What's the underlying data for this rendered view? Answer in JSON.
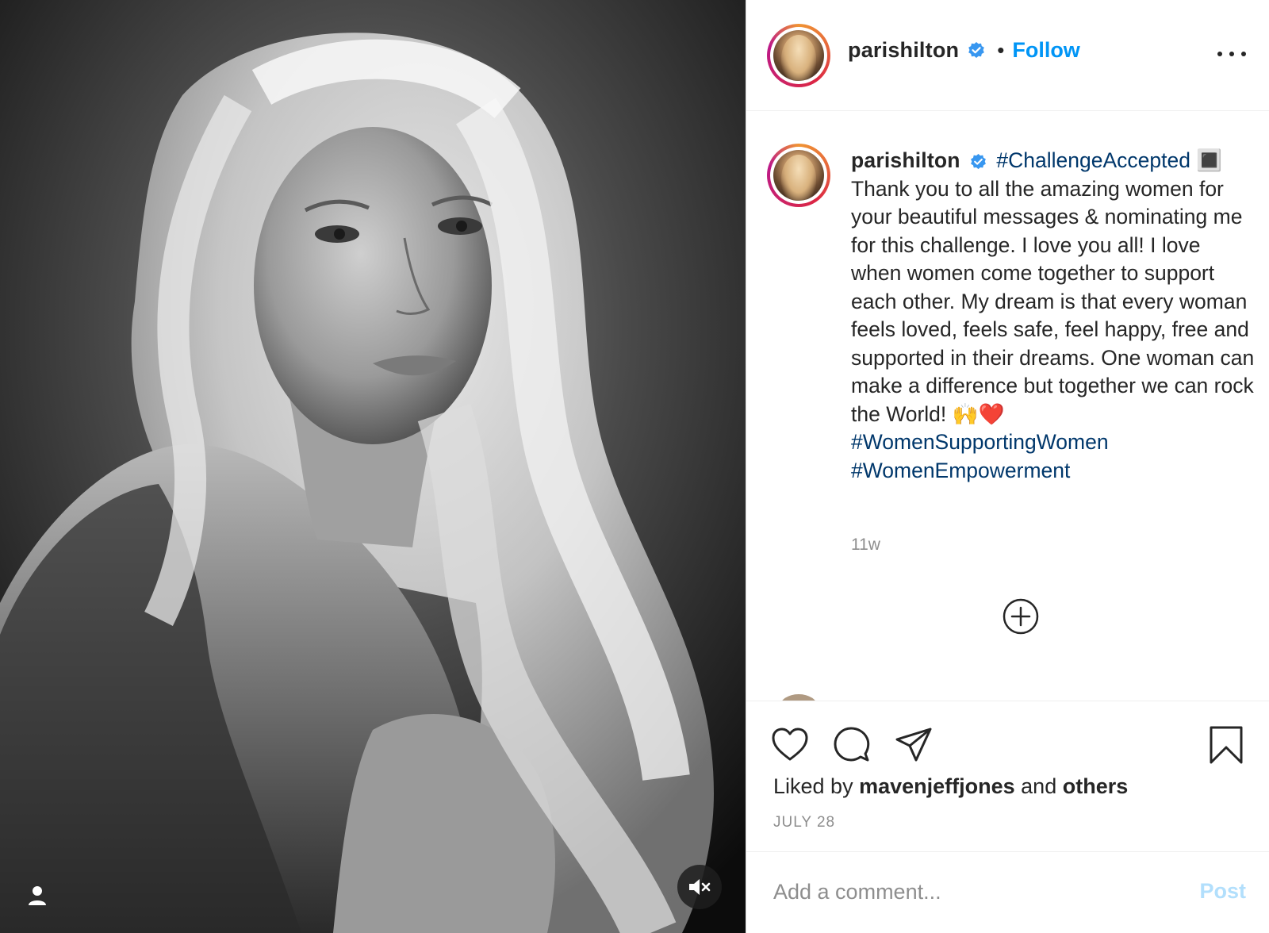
{
  "post": {
    "username": "parishilton",
    "verified": true,
    "follow_label": "Follow",
    "separator": "•",
    "more_icon": "more-horizontal-icon"
  },
  "caption": {
    "username": "parishilton",
    "hashtag_challenge": "#ChallengeAccepted",
    "hashtag_emoji": "🔳",
    "text": "Thank you to all the amazing women for your beautiful messages & nominating me for this challenge. I love you all! I love when women come together to support each other. My dream is that every woman feels loved, feels safe, feel happy, free and supported in their dreams. One woman can make a difference but together we can rock the World! 🙌❤️",
    "hashtag_1": "#WomenSupportingWomen",
    "hashtag_2": "#WomenEmpowerment",
    "time_ago": "11w"
  },
  "actions": {
    "like_icon": "heart-icon",
    "comment_icon": "comment-icon",
    "share_icon": "paper-plane-icon",
    "save_icon": "bookmark-icon"
  },
  "likes": {
    "prefix": "Liked by ",
    "user": "mavenjeffjones",
    "middle": " and ",
    "others": "others"
  },
  "date": "JULY 28",
  "add_comment": {
    "placeholder": "Add a comment...",
    "post_label": "Post"
  },
  "colors": {
    "accent": "#0095f6",
    "hashtag": "#00376b",
    "muted": "#8e8e8e",
    "post_disabled": "#b2dffc"
  }
}
